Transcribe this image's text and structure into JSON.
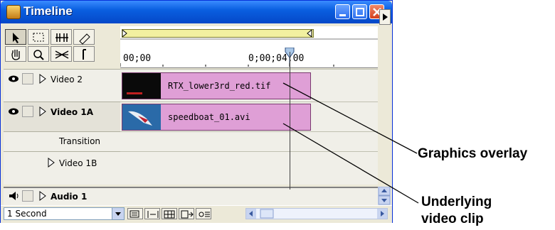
{
  "window": {
    "title": "Timeline",
    "ruler": {
      "start_label": "00;00",
      "mid_label": "0;00;04;00"
    }
  },
  "tracks": [
    {
      "label": "Video 2",
      "bold": false,
      "clip": "RTX_lower3rd_red.tif"
    },
    {
      "label": "Video 1A",
      "bold": true,
      "clip": "speedboat_01.avi"
    },
    {
      "label": "Transition",
      "bold": false
    },
    {
      "label": "Video 1B",
      "bold": false
    },
    {
      "label": "Audio 1",
      "bold": true
    }
  ],
  "status": {
    "zoom": "1 Second"
  },
  "callouts": {
    "graphics": "Graphics overlay",
    "underlying_line1": "Underlying",
    "underlying_line2": "video clip"
  },
  "colors": {
    "clip_fill": "#df9fd6",
    "titlebar": "#0548c8"
  }
}
